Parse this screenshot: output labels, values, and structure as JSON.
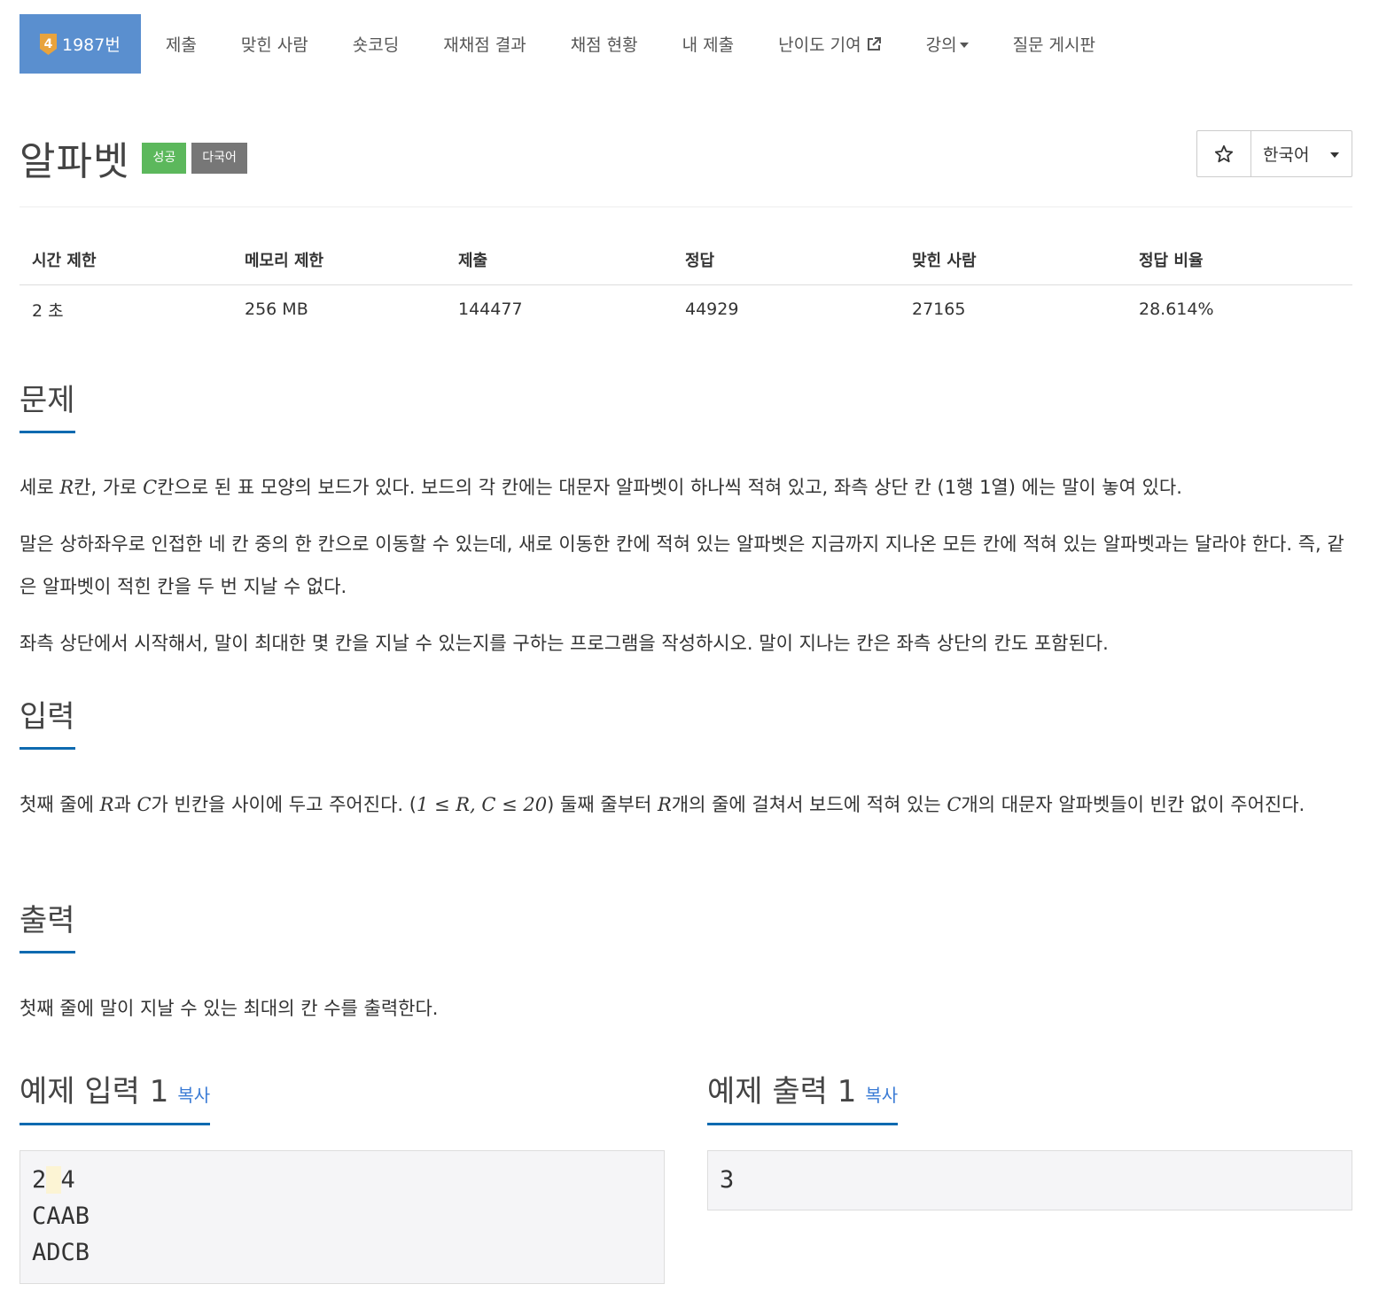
{
  "nav": {
    "problem_label": "1987번",
    "tier_number": "4",
    "items": [
      {
        "label": "제출"
      },
      {
        "label": "맞힌 사람"
      },
      {
        "label": "숏코딩"
      },
      {
        "label": "재채점 결과"
      },
      {
        "label": "채점 현황"
      },
      {
        "label": "내 제출"
      },
      {
        "label": "난이도 기여"
      },
      {
        "label": "강의"
      },
      {
        "label": "질문 게시판"
      }
    ]
  },
  "title": {
    "text": "알파벳",
    "badge_success": "성공",
    "badge_multilang": "다국어"
  },
  "controls": {
    "star_icon": "star-outline-icon",
    "language": "한국어"
  },
  "info": {
    "headers": [
      "시간 제한",
      "메모리 제한",
      "제출",
      "정답",
      "맞힌 사람",
      "정답 비율"
    ],
    "values": [
      "2 초",
      "256 MB",
      "144477",
      "44929",
      "27165",
      "28.614%"
    ]
  },
  "problem": {
    "heading": "문제",
    "p1_a": "세로 ",
    "p1_b": "칸, 가로 ",
    "p1_c": "칸으로 된 표 모양의 보드가 있다. 보드의 각 칸에는 대문자 알파벳이 하나씩 적혀 있고, 좌측 상단 칸 (1행 1열) 에는 말이 놓여 있다.",
    "p2": "말은 상하좌우로 인접한 네 칸 중의 한 칸으로 이동할 수 있는데, 새로 이동한 칸에 적혀 있는 알파벳은 지금까지 지나온 모든 칸에 적혀 있는 알파벳과는 달라야 한다. 즉, 같은 알파벳이 적힌 칸을 두 번 지날 수 없다.",
    "p3": "좌측 상단에서 시작해서, 말이 최대한 몇 칸을 지날 수 있는지를 구하는 프로그램을 작성하시오. 말이 지나는 칸은 좌측 상단의 칸도 포함된다."
  },
  "input": {
    "heading": "입력",
    "t1": "첫째 줄에 ",
    "t2": "과 ",
    "t3": "가 빈칸을 사이에 두고 주어진다. (",
    "t4": ") 둘째 줄부터 ",
    "t5": "개의 줄에 걸쳐서 보드에 적혀 있는 ",
    "t6": "개의 대문자 알파벳들이 빈칸 없이 주어진다.",
    "var_r": "R",
    "var_c": "C",
    "constraint": "1 ≤ R, C ≤ 20"
  },
  "output": {
    "heading": "출력",
    "text": "첫째 줄에 말이 지날 수 있는 최대의 칸 수를 출력한다."
  },
  "samples": {
    "input_heading": "예제 입력 1",
    "output_heading": "예제 출력 1",
    "copy_label": "복사",
    "input_line1_a": "2",
    "input_line1_b": " ",
    "input_line1_c": "4",
    "input_line2": "CAAB",
    "input_line3": "ADCB",
    "output_text": "3"
  }
}
